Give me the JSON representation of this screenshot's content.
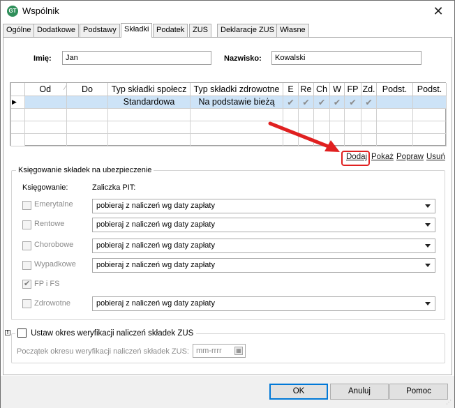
{
  "window": {
    "title": "Wspólnik",
    "icon": "app-logo-icon",
    "icon_text": "GT"
  },
  "tabs": [
    {
      "label": "Ogólne",
      "active": false
    },
    {
      "label": "Dodatkowe",
      "active": false
    },
    {
      "label": "Podstawy",
      "active": false
    },
    {
      "label": "Składki",
      "active": true
    },
    {
      "label": "Podatek",
      "active": false
    },
    {
      "label": "ZUS",
      "active": false
    },
    {
      "label": "Deklaracje ZUS",
      "active": false
    },
    {
      "label": "Własne",
      "active": false
    }
  ],
  "person": {
    "first_name_label": "Imię:",
    "first_name_value": "Jan",
    "last_name_label": "Nazwisko:",
    "last_name_value": "Kowalski"
  },
  "grid": {
    "columns": [
      "Od",
      "Do",
      "Typ składki społecz",
      "Typ składki zdrowotne",
      "E",
      "Re",
      "Ch",
      "W",
      "FP",
      "Zd.",
      "Podst.",
      "Podst."
    ],
    "rows": [
      {
        "od": "",
        "do": "",
        "typ_spol": "Standardowa",
        "typ_zdrow": "Na podstawie bieżą",
        "checks": [
          "✔",
          "✔",
          "✔",
          "✔",
          "✔",
          "✔"
        ],
        "podst1": "",
        "podst2": ""
      }
    ]
  },
  "actions": {
    "add": "Dodaj",
    "show": "Pokaż",
    "edit": "Popraw",
    "delete": "Usuń"
  },
  "booking": {
    "title": "Księgowanie składek na ubezpieczenie",
    "col1_header": "Księgowanie:",
    "col2_header": "Zaliczka PIT:",
    "items": [
      {
        "label": "Emerytalne",
        "checked": false,
        "select": "pobieraj z naliczeń wg daty zapłaty"
      },
      {
        "label": "Rentowe",
        "checked": false,
        "select": "pobieraj z naliczeń wg daty zapłaty"
      },
      {
        "label": "Chorobowe",
        "checked": false,
        "select": "pobieraj z naliczeń wg daty zapłaty"
      },
      {
        "label": "Wypadkowe",
        "checked": false,
        "select": "pobieraj z naliczeń wg daty zapłaty"
      },
      {
        "label": "FP i FS",
        "checked": true,
        "select": ""
      },
      {
        "label": "Zdrowotne",
        "checked": false,
        "select": "pobieraj z naliczeń wg daty zapłaty"
      }
    ]
  },
  "verification": {
    "checkbox_label": "Ustaw okres weryfikacji naliczeń składek ZUS",
    "start_label": "Początek okresu weryfikacji naliczeń składek ZUS:",
    "start_placeholder": "mm-rrrr"
  },
  "buttons": {
    "ok": "OK",
    "cancel": "Anuluj",
    "help": "Pomoc"
  },
  "colors": {
    "selected_row": "#cde3f7",
    "highlight": "#e02020",
    "arrow": "#e02020",
    "default_button_border": "#0078d7"
  }
}
